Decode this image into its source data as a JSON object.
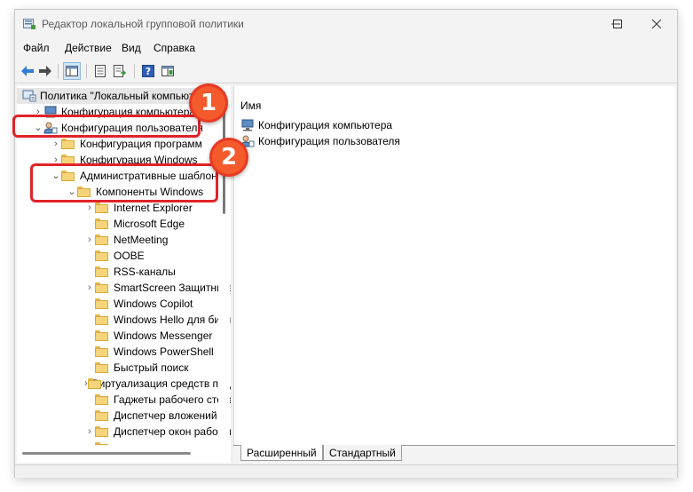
{
  "window": {
    "title": "Редактор локальной групповой политики"
  },
  "menu": {
    "items": [
      "Файл",
      "Действие",
      "Вид",
      "Справка"
    ]
  },
  "toolbar": {
    "buttons": [
      "back-arrow-icon",
      "forward-arrow-icon",
      "show-hide-tree-icon",
      "properties-icon",
      "export-list-icon",
      "help-icon",
      "extended-view-icon"
    ]
  },
  "tree": {
    "items": [
      {
        "label": "Политика \"Локальный компьютер\"",
        "icon": "computer-policy-icon",
        "expanded": true,
        "level": 0
      },
      {
        "label": "Конфигурация компьютера",
        "icon": "computer-icon",
        "expanded": false,
        "level": 1
      },
      {
        "label": "Конфигурация пользователя",
        "icon": "user-icon",
        "expanded": true,
        "level": 1
      },
      {
        "label": "Конфигурация программ",
        "icon": "folder-icon",
        "expanded": false,
        "level": 2
      },
      {
        "label": "Конфигурация Windows",
        "icon": "folder-icon",
        "expanded": false,
        "level": 2
      },
      {
        "label": "Административные шаблоны",
        "icon": "folder-icon",
        "expanded": true,
        "level": 2
      },
      {
        "label": "Компоненты Windows",
        "icon": "folder-icon",
        "expanded": true,
        "level": 3
      },
      {
        "label": "Internet Explorer",
        "icon": "folder-icon",
        "expanded": false,
        "level": 4
      },
      {
        "label": "Microsoft Edge",
        "icon": "folder-icon",
        "level": 4
      },
      {
        "label": "NetMeeting",
        "icon": "folder-icon",
        "expanded": false,
        "level": 4
      },
      {
        "label": "OOBE",
        "icon": "folder-icon",
        "level": 4
      },
      {
        "label": "RSS-каналы",
        "icon": "folder-icon",
        "level": 4
      },
      {
        "label": "SmartScreen Защитника Windows",
        "icon": "folder-icon",
        "expanded": false,
        "level": 4
      },
      {
        "label": "Windows Copilot",
        "icon": "folder-icon",
        "level": 4
      },
      {
        "label": "Windows Hello для бизнеса",
        "icon": "folder-icon",
        "level": 4
      },
      {
        "label": "Windows Messenger",
        "icon": "folder-icon",
        "level": 4
      },
      {
        "label": "Windows PowerShell",
        "icon": "folder-icon",
        "level": 4
      },
      {
        "label": "Быстрый поиск",
        "icon": "folder-icon",
        "level": 4
      },
      {
        "label": "Виртуализация средств представления",
        "icon": "folder-icon",
        "expanded": false,
        "level": 4
      },
      {
        "label": "Гаджеты рабочего стола",
        "icon": "folder-icon",
        "level": 4
      },
      {
        "label": "Диспетчер вложений",
        "icon": "folder-icon",
        "level": 4
      },
      {
        "label": "Диспетчер окон рабочего стола",
        "icon": "folder-icon",
        "expanded": false,
        "level": 4
      }
    ]
  },
  "list": {
    "column_header": "Имя",
    "rows": [
      {
        "label": "Конфигурация компьютера",
        "icon": "computer-icon"
      },
      {
        "label": "Конфигурация пользователя",
        "icon": "user-icon"
      }
    ]
  },
  "tabs": {
    "items": [
      "Расширенный",
      "Стандартный"
    ],
    "active": "Стандартный"
  },
  "annotations": {
    "badge1": "1",
    "badge2": "2",
    "color": "#e0232a"
  }
}
